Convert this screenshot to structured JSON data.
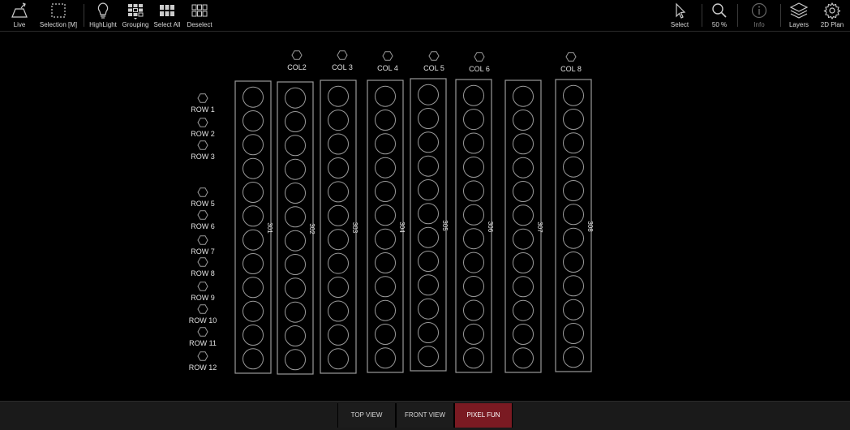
{
  "toolbar": {
    "left": [
      {
        "id": "live",
        "label": "Live",
        "icon": "live-icon"
      },
      {
        "id": "selection",
        "label": "Selection [M]",
        "icon": "selection-box-icon"
      },
      {
        "id": "highlight",
        "label": "HighLight",
        "icon": "lightbulb-icon"
      },
      {
        "id": "grouping",
        "label": "Grouping",
        "icon": "grouping-grid-icon"
      },
      {
        "id": "select-all",
        "label": "Select All",
        "icon": "select-all-grid-icon"
      },
      {
        "id": "deselect",
        "label": "Deselect",
        "icon": "deselect-grid-icon"
      }
    ],
    "right": [
      {
        "id": "select",
        "label": "Select",
        "icon": "cursor-icon"
      },
      {
        "id": "zoom",
        "label": "50 %",
        "icon": "magnifier-icon"
      },
      {
        "id": "info",
        "label": "Info",
        "icon": "info-icon"
      },
      {
        "id": "layers",
        "label": "Layers",
        "icon": "layers-icon"
      },
      {
        "id": "plan",
        "label": "2D Plan",
        "icon": "gear-icon"
      }
    ]
  },
  "canvas": {
    "rows": [
      "ROW 1",
      "ROW 2",
      "ROW 3",
      "ROW 5",
      "ROW 6",
      "ROW 7",
      "ROW 8",
      "ROW 9",
      "ROW 10",
      "ROW 11",
      "ROW 12"
    ],
    "cols": [
      "COL2",
      "COL 3",
      "COL 4",
      "COL 5",
      "COL 6",
      "COL 8"
    ],
    "fixtures": [
      "301",
      "302",
      "303",
      "304",
      "305",
      "306",
      "307",
      "308"
    ],
    "cells_per_fixture": 12
  },
  "views": [
    {
      "id": "top",
      "label": "TOP VIEW",
      "active": false
    },
    {
      "id": "front",
      "label": "FRONT VIEW",
      "active": false
    },
    {
      "id": "pixel",
      "label": "PIXEL FUN",
      "active": true
    }
  ],
  "colors": {
    "active_view": "#7a1a22",
    "stroke": "#9a9a9a"
  }
}
